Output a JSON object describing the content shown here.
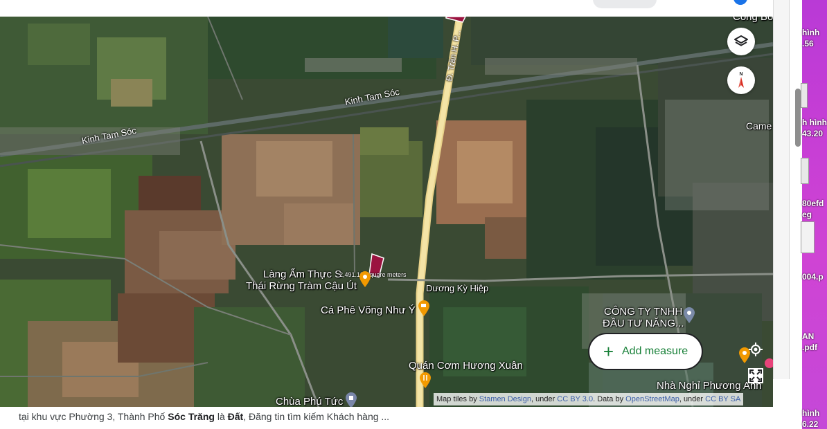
{
  "map": {
    "place_labels": {
      "restaurant_line1": "Làng Ẩm Thực S",
      "restaurant_line2": "Thái Rừng Tràm Cậu Út",
      "cafe": "Cá Phê Võng Như Ý",
      "quan_com": "Quán Cơm Hương Xuân",
      "chua": "Chùa Phú Tức",
      "company_line1": "CÔNG TY TNHH",
      "company_line2": "ĐẦU TƯ NĂNG...",
      "nha_nghi": "Nhà Nghỉ Phương Anh",
      "duong_ky_hiep": "Dương Kỳ Hiệp",
      "cong_bo": "Cổng Bờ",
      "came": "Came"
    },
    "road_labels": {
      "kinh_tam_soc_left": "Kinh Tam Sóc",
      "kinh_tam_soc_right": "Kinh Tam Sóc",
      "tran_hung_dao": "Đ. Trần H. P..."
    },
    "measure_value": "2,491.19 Square meters",
    "controls": {
      "layers_icon": "layers-icon",
      "compass_icon": "compass-north-icon",
      "add_measure_label": "Add measure",
      "my_location_icon": "crosshair-icon",
      "fullscreen_icon": "fullscreen-icon"
    },
    "attribution": {
      "prefix": "Map tiles by",
      "stamen": "Stamen Design",
      "under1": ", under",
      "cc_by": "CC BY 3.0",
      "data_by": ". Data by",
      "osm": "OpenStreetMap",
      "under2": ", under",
      "cc_by_sa": "CC BY SA"
    }
  },
  "caption": {
    "part1": "tại khu vực Phường 3, Thành Phố",
    "city": "Sóc Trăng",
    "part2": "là",
    "type": "Đất",
    "part3": ", Đăng tin tìm kiếm Khách hàng ..."
  },
  "desktop": {
    "labels": [
      "hình",
      ".56",
      "h hình",
      "43.20",
      "80efd",
      "eg",
      "004.p",
      "AN",
      ".pdf",
      "hình",
      "6.22"
    ]
  },
  "colors": {
    "accent_green": "#188038",
    "parcel": "#9b1340",
    "desktop_purple": "#c63ed5"
  }
}
